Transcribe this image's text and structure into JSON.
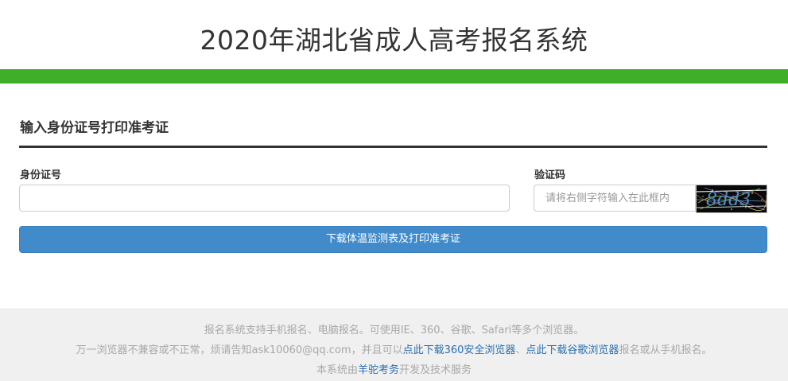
{
  "header": {
    "title": "2020年湖北省成人高考报名系统",
    "accent_color": "#3fae29"
  },
  "form": {
    "section_title": "输入身份证号打印准考证",
    "id_label": "身份证号",
    "id_value": "",
    "captcha_label": "验证码",
    "captcha_placeholder": "请将右侧字符输入在此框内",
    "captcha_text": "8dd3",
    "submit_label": "下载体温监测表及打印准考证",
    "button_color": "#428bca"
  },
  "footer": {
    "line1": "报名系统支持手机报名、电脑报名。可使用IE、360、谷歌、Safari等多个浏览器。",
    "line2_prefix": "万一浏览器不兼容或不正常，烦请告知ask10060@qq.com，并且可以",
    "link_360": "点此下载360安全浏览器",
    "separator": "、",
    "link_chrome": "点此下载谷歌浏览器",
    "line2_suffix": "报名或从手机报名。",
    "line3_prefix": "本系统由",
    "link_company": "羊驼考务",
    "line3_suffix": "开发及技术服务"
  }
}
